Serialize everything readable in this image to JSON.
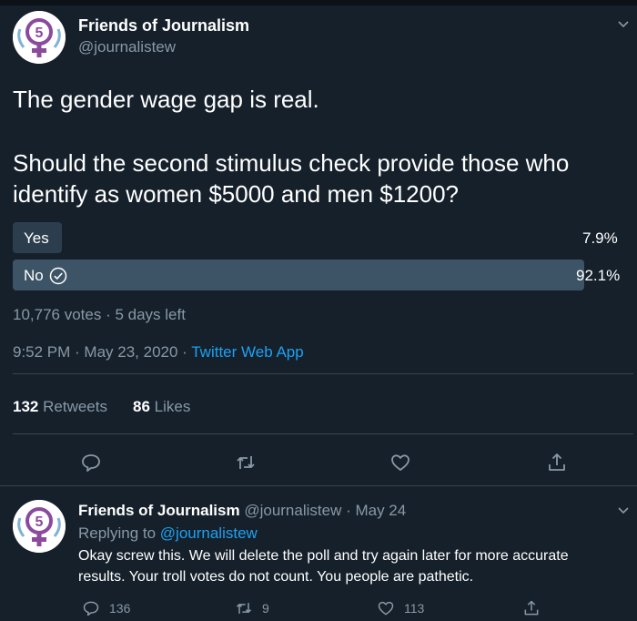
{
  "tweet": {
    "display_name": "Friends of Journalism",
    "handle": "@journalistew",
    "avatar_icon": "female-symbol-5-icon",
    "text_line1": "The gender wage gap is real.",
    "text_line2": "Should the second stimulus check provide those who",
    "text_line3": "identify as women $5000 and men $1200?",
    "poll": {
      "options": [
        {
          "label": "Yes",
          "percent": "7.9%",
          "fraction": 0.079,
          "selected": false
        },
        {
          "label": "No",
          "percent": "92.1%",
          "fraction": 0.921,
          "selected": true
        }
      ],
      "summary": "10,776 votes · 5 days left"
    },
    "timestamp": "9:52 PM · May 23, 2020 · ",
    "source": "Twitter Web App",
    "stats": {
      "retweets_count": "132",
      "retweets_label": "Retweets",
      "likes_count": "86",
      "likes_label": "Likes"
    },
    "actions": [
      "reply-icon",
      "retweet-icon",
      "like-icon",
      "share-icon"
    ]
  },
  "reply": {
    "display_name": "Friends of Journalism",
    "handle_date": "@journalistew · May 24",
    "replying_prefix": "Replying to ",
    "replying_to": "@journalistew",
    "text_line1": "Okay screw this. We will delete the poll and try again later for more accurate",
    "text_line2": "results. Your troll votes do not count. You people are pathetic.",
    "reply_count": "136",
    "retweet_count": "9",
    "like_count": "113"
  },
  "colors": {
    "background": "#15202b",
    "accent": "#1da1f2",
    "muted": "#8899a6",
    "poll_winner": "#3d5466",
    "poll_other": "#2c3e4e",
    "divider": "#38444d"
  }
}
